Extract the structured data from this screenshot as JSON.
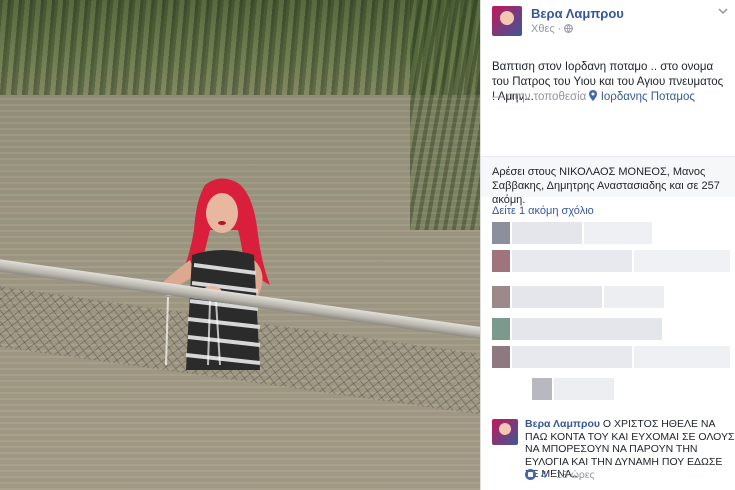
{
  "post": {
    "author": "Βερα Λαμπρου",
    "time": "Χθες",
    "privacy_icon": "globe-icon",
    "menu_icon": "chevron-down-icon",
    "text": "Βαπτιση στον Ιορδανη ποταμο .. στο ονομα του Πατρος του Υιου και του Αγιου πνευματος ! Αμην...",
    "location_prefix": "— στην τοποθεσία",
    "location": "Ιορδανης Ποταμος"
  },
  "likes": {
    "text": "Αρέσει στους ΝΙΚΟΛΑΟΣ ΜΟΝΕΟΣ, Μανος Σαββακης, Δημητρης Αναστασιαδης και σε 257 ακόμη."
  },
  "comments": {
    "more_label": "Δείτε 1 ακόμη σχόλιο",
    "last": {
      "author": "Βερα Λαμπρου",
      "text": "Ο ΧΡΙΣΤΟΣ ΗΘΕΛΕ ΝΑ ΠΑΩ ΚΟΝΤΑ ΤΟΥ ΚΑΙ ΕΥΧΟΜΑΙ ΣΕ ΟΛΟΥΣ ΝΑ ΜΠΟΡΕΣΟΥΝ ΝΑ ΠΑΡΟΥΝ ΤΗΝ ΕΥΛΟΓΙΑ ΚΑΙ ΤΗΝ ΔΥΝΑΜΗ ΠΟΥ ΕΔΩΣΕ ΣΕ ΜΕΝΑ..",
      "like_count": "4",
      "time": "13 ώρες"
    }
  },
  "colors": {
    "link": "#365899",
    "muted": "#90949c",
    "like_blue": "#4267b2"
  }
}
